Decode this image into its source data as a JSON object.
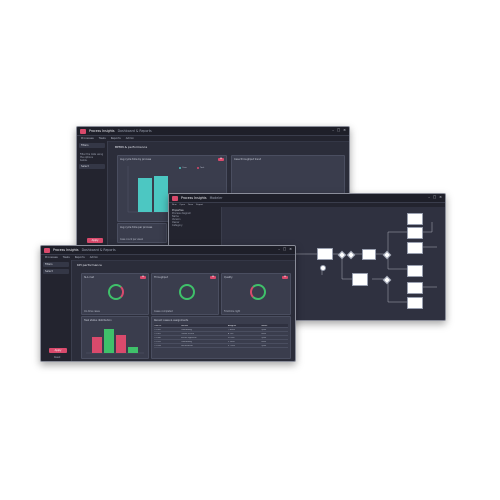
{
  "window_back": {
    "app_title": "Process Insights",
    "breadcrumb": "Dashboard & Reports",
    "menu": [
      "Processes",
      "Tasks",
      "Reports",
      "Admin"
    ],
    "filter_label": "Filters",
    "sidebar_text": [
      "Filter the data using the options",
      "below.",
      "Select"
    ],
    "button": "Apply",
    "dashboard_title": "BPMN & performance",
    "panel_left_title": "Avg cycle time by process",
    "panel_right_title": "Case throughput trend",
    "chart_legend": [
      "Case",
      "Task"
    ],
    "foot_text": [
      "Avg cycle time per process",
      "Case count per week"
    ]
  },
  "window_mid": {
    "app_title": "Process Insights",
    "breadcrumb": "Modeler",
    "toolbar": [
      "New",
      "Open",
      "Save",
      "Export"
    ],
    "props": [
      "Properties",
      "Process diagram",
      "Name",
      "Version",
      "Owner",
      "Category"
    ]
  },
  "window_front": {
    "app_title": "Process Insights",
    "breadcrumb": "Dashboard & Reports",
    "menu": [
      "Processes",
      "Tasks",
      "Reports",
      "Admin"
    ],
    "filter_label": "Filters",
    "sidebar_text": [
      "Select"
    ],
    "button": "Apply",
    "button2": "Reset",
    "dashboard_title": "KPI performance",
    "kpi_panels": [
      {
        "title": "SLA met",
        "foot": "On-time cases"
      },
      {
        "title": "Throughput",
        "foot": "Cases completed"
      },
      {
        "title": "Quality",
        "foot": "First-time right"
      }
    ],
    "bottom_left_title": "Task status distribution",
    "bottom_right_title": "Recent cases & assignments",
    "table_headers": [
      "Case ID",
      "Process",
      "Assignee",
      "Status"
    ],
    "table_rows": [
      [
        "C-1042",
        "Onboarding",
        "J. Smith",
        "Open"
      ],
      [
        "C-1041",
        "Claims review",
        "A. Lee",
        "Done"
      ],
      [
        "C-1040",
        "Invoice approval",
        "M. Ruiz",
        "Open"
      ],
      [
        "C-1039",
        "Onboarding",
        "K. Patel",
        "Done"
      ],
      [
        "C-1038",
        "Procurement",
        "S. Chen",
        "Open"
      ]
    ]
  },
  "colors": {
    "accent": "#d94a6c",
    "ok": "#3fc16a",
    "teal": "#4cc7c2",
    "bg": "#2b2d3a"
  }
}
